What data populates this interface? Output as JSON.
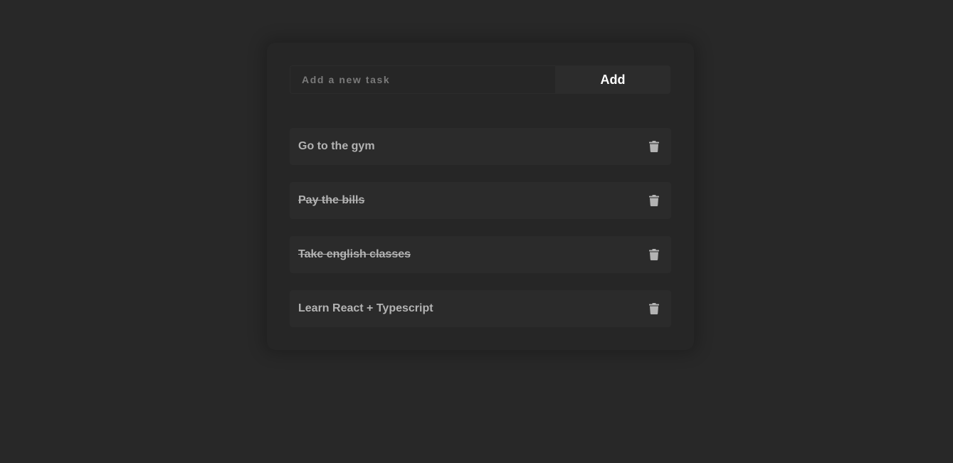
{
  "input": {
    "placeholder": "Add a new task",
    "value": ""
  },
  "add_button": {
    "label": "Add"
  },
  "tasks": [
    {
      "text": "Go to the gym",
      "completed": false,
      "delete_icon": "trash-icon"
    },
    {
      "text": "Pay the bills",
      "completed": true,
      "delete_icon": "trash-icon"
    },
    {
      "text": "Take english classes",
      "completed": true,
      "delete_icon": "trash-icon"
    },
    {
      "text": "Learn React + Typescript",
      "completed": false,
      "delete_icon": "trash-icon"
    }
  ],
  "colors": {
    "background": "#282828",
    "card": "#262626",
    "item": "#2b2b2b",
    "text": "#b3b3b3",
    "button_text": "#ffffff"
  }
}
